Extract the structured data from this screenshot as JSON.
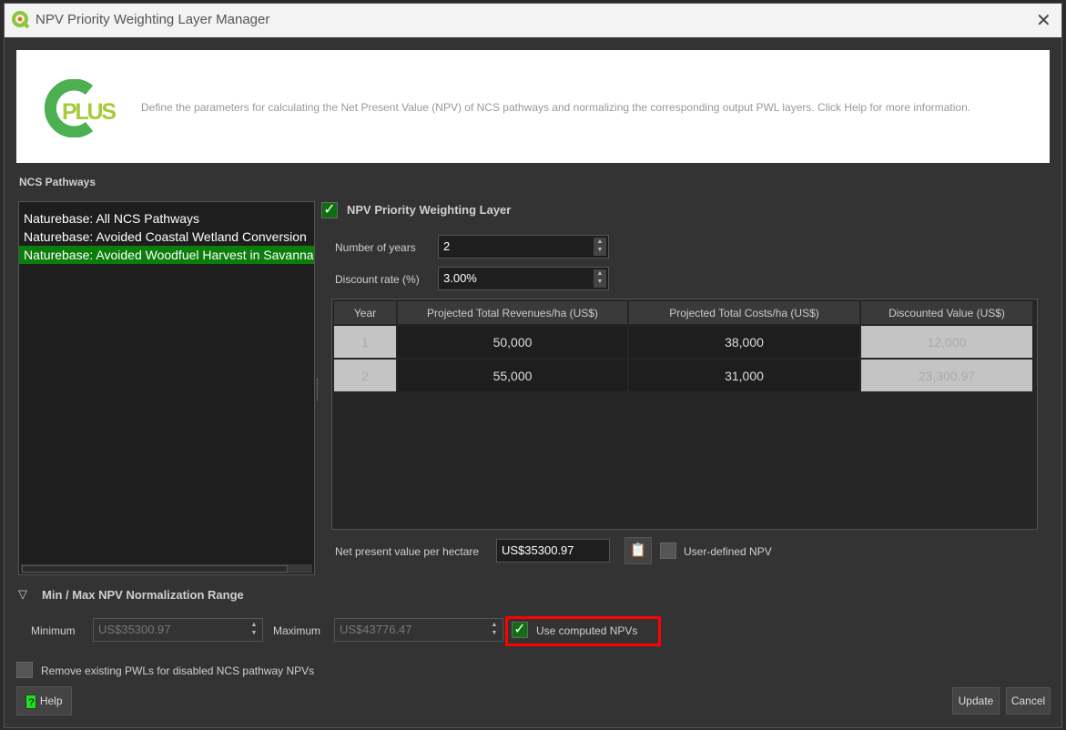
{
  "window": {
    "title": "NPV Priority Weighting Layer Manager",
    "close_icon": "close-icon"
  },
  "banner": {
    "logo_text": "PLUS",
    "description": "Define the parameters for calculating the Net Present Value (NPV) of NCS pathways and normalizing the corresponding output PWL layers. Click Help for more information."
  },
  "pathways": {
    "label": "NCS Pathways",
    "items": [
      {
        "label": "Naturebase: All NCS Pathways",
        "selected": false
      },
      {
        "label": "Naturebase: Avoided Coastal Wetland Conversion",
        "selected": false
      },
      {
        "label": "Naturebase: Avoided Woodfuel Harvest in Savannas",
        "selected": true
      }
    ]
  },
  "npv": {
    "enabled_label": "NPV Priority Weighting Layer",
    "enabled": true,
    "years_label": "Number of years",
    "years_value": "2",
    "rate_label": "Discount rate (%)",
    "rate_value": "3.00%",
    "table": {
      "headers": [
        "Year",
        "Projected Total Revenues/ha (US$)",
        "Projected Total Costs/ha (US$)",
        "Discounted Value (US$)"
      ],
      "rows": [
        [
          "1",
          "50,000",
          "38,000",
          "12,000"
        ],
        [
          "2",
          "55,000",
          "31,000",
          "23,300.97"
        ]
      ]
    },
    "npv_label": "Net present value per hectare",
    "npv_value": "US$35300.97",
    "user_defined_label": "User-defined NPV",
    "user_defined": false
  },
  "normalization": {
    "heading": "Min / Max NPV Normalization Range",
    "min_label": "Minimum",
    "min_value": "US$35300.97",
    "max_label": "Maximum",
    "max_value": "US$43776.47",
    "use_computed_label": "Use computed NPVs",
    "use_computed": true
  },
  "remove_label": "Remove existing PWLs for disabled NCS pathway NPVs",
  "buttons": {
    "help": "Help",
    "update": "Update",
    "cancel": "Cancel"
  },
  "colors": {
    "accent": "#0a7d0a",
    "highlight": "#ff0000"
  }
}
